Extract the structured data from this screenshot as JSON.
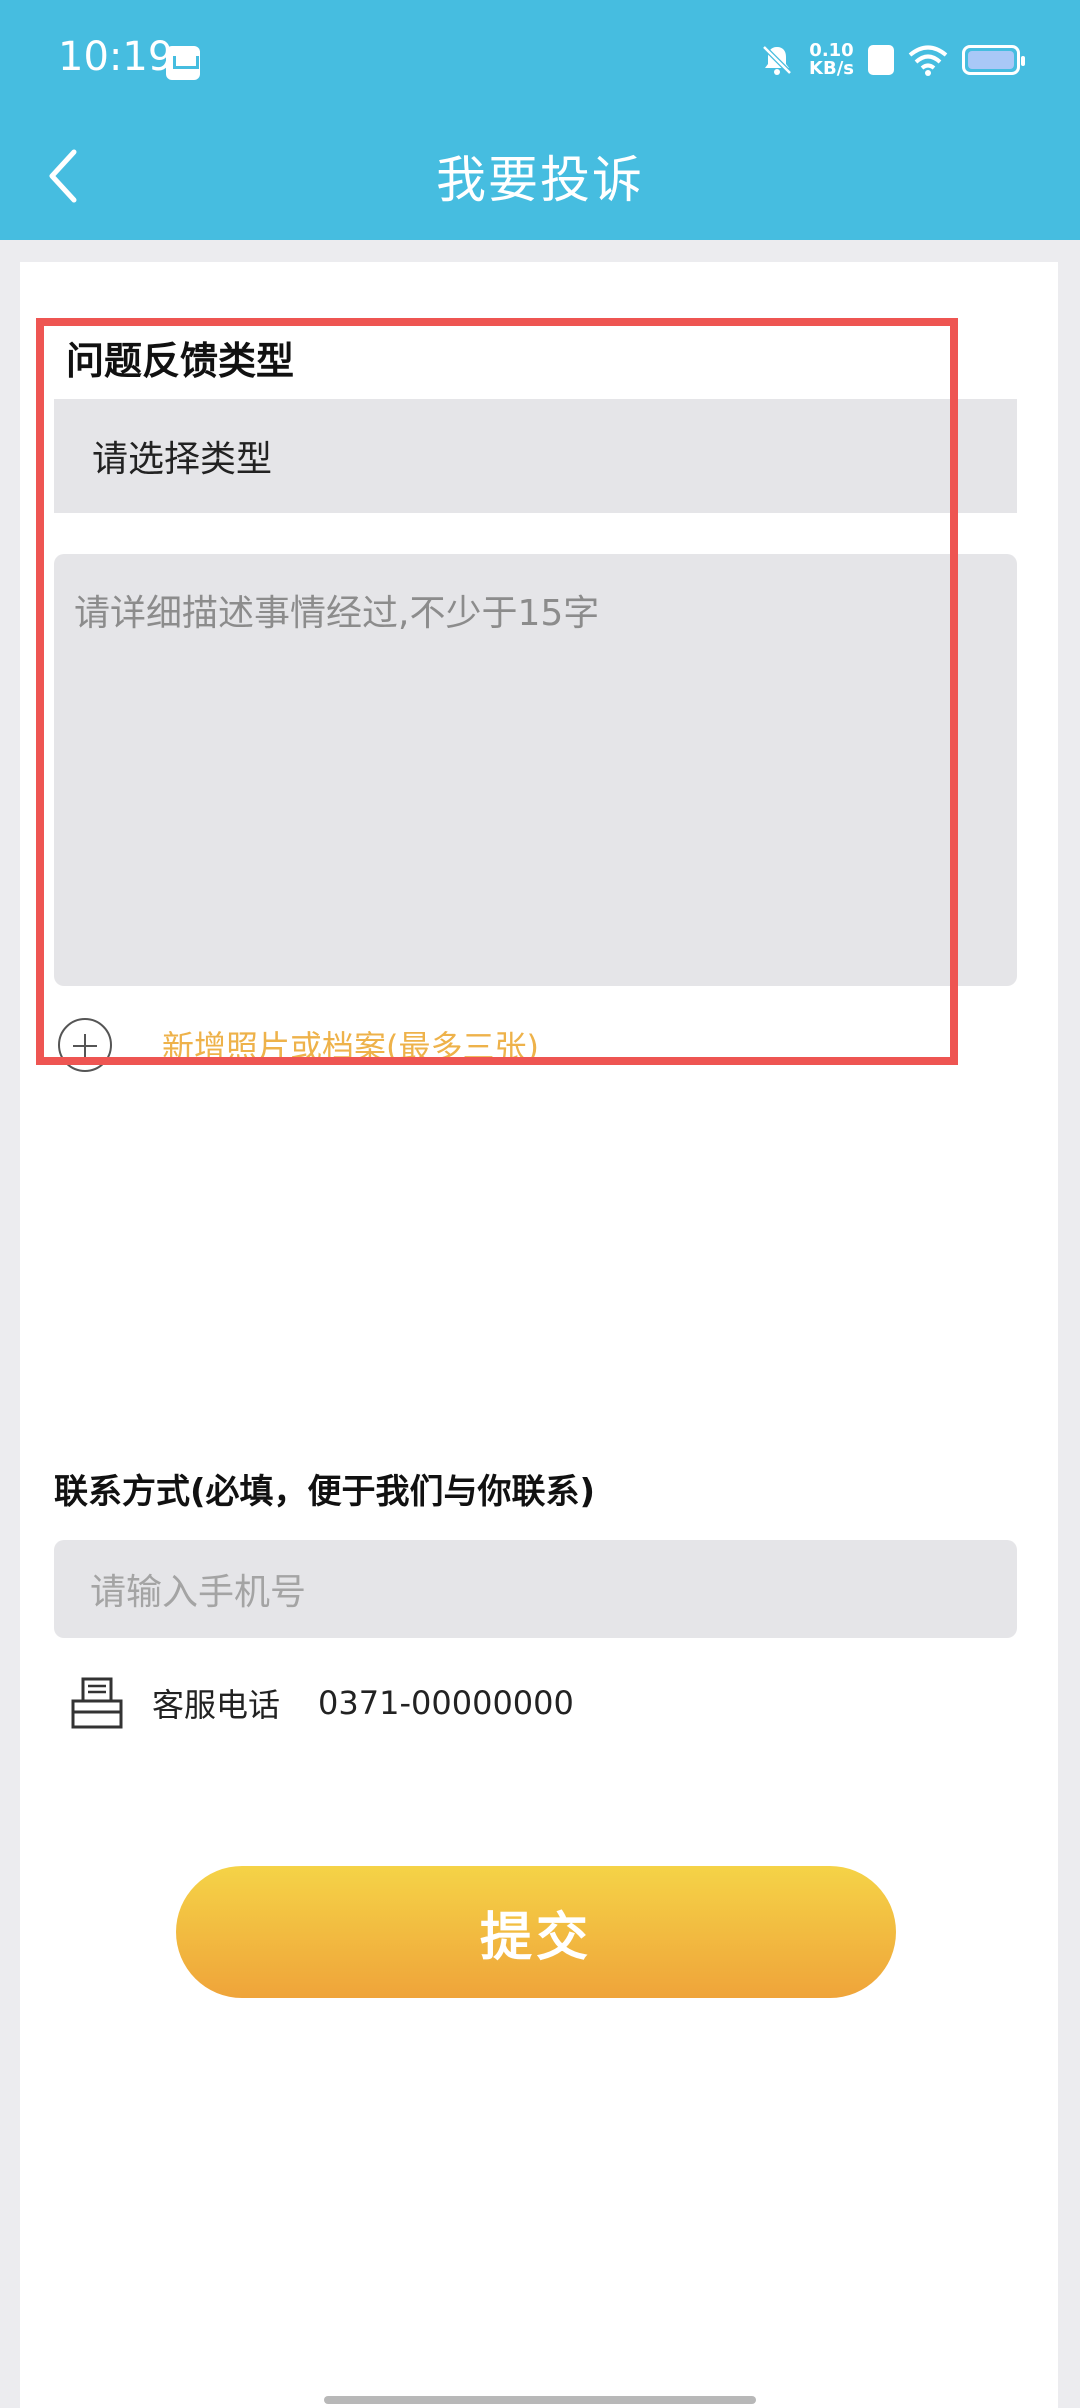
{
  "status_bar": {
    "time": "10:19",
    "net_speed_value": "0.10",
    "net_speed_unit": "KB/s",
    "icons": [
      "app-notification-icon",
      "mute-icon",
      "sim-icon",
      "wifi-icon",
      "battery-icon"
    ]
  },
  "header": {
    "title": "我要投诉",
    "back_icon": "chevron-left-icon",
    "background_color": "#46bde0"
  },
  "form": {
    "type_section_label": "问题反馈类型",
    "type_select_value": "请选择类型",
    "description_placeholder": "请详细描述事情经过,不少于15字",
    "add_attachment_label": "新增照片或档案(最多三张)",
    "contact_label": "联系方式(必填，便于我们与你联系)",
    "phone_placeholder": "请输入手机号",
    "service_label": "客服电话",
    "service_phone": "0371-00000000",
    "submit_label": "提交"
  },
  "colors": {
    "accent_orange": "#eeb24a",
    "highlight_red": "#ee5552",
    "button_gradient_top": "#f5d347",
    "button_gradient_bottom": "#efa43a"
  }
}
